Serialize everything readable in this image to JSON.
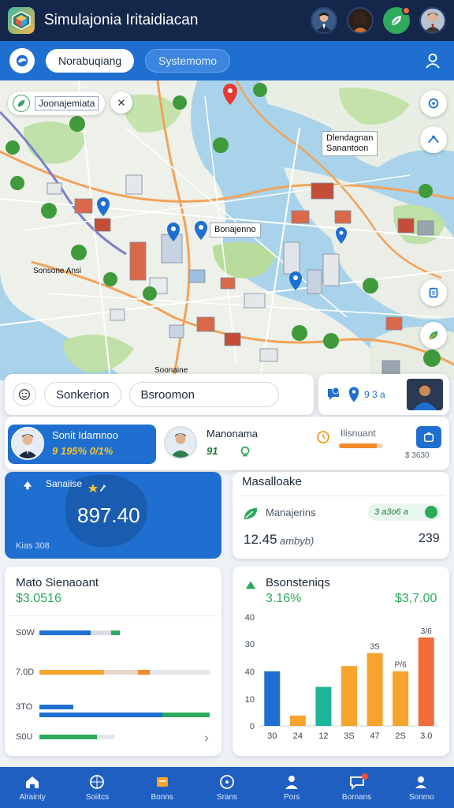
{
  "app": {
    "title": "Simulajonia Iritaidiacan"
  },
  "subbar": {
    "tab_active": "Norabuqiang",
    "tab_inactive": "Systemomo"
  },
  "map": {
    "chip_label": "Joonajemiata",
    "label_right_top_line1": "Dlendagnan",
    "label_right_top_line2": "Sanantoon",
    "label_center": "Bonajenno",
    "label_left": "Sonsone Ansi",
    "label_bottom": "Soonaine"
  },
  "filters": {
    "pill_1": "Sonkerion",
    "pill_2": "Bsroomon",
    "pin_text": "9 3 a"
  },
  "profiles": {
    "a_name": "Sonit Idamnoo",
    "a_sub": "9 195% 0/1%",
    "b_name": "Manonama",
    "b_sub": "91",
    "c_name": "Ilisnuant",
    "c_value": "$ 3630",
    "c_progress": 0.85
  },
  "card_blue": {
    "title": "Sanaiise",
    "value": "897.40",
    "foot": "Kias 308"
  },
  "card_market": {
    "title": "Masalloake",
    "row_label": "Manajerins",
    "row_badge": "3 a3o6 a",
    "row_value": "12.45",
    "row_unit": "ambyb)",
    "row_right": "239"
  },
  "card_hbars": {
    "title": "Mato Sienaoant",
    "value": "$3.0516",
    "rows": [
      {
        "label": "S0W",
        "segments": [
          {
            "v": 0.3,
            "c": "#1f6fd0"
          },
          {
            "v": 0.12,
            "c": "#d9dde3"
          },
          {
            "v": 0.05,
            "c": "#2eaa5c"
          }
        ]
      },
      {
        "label": "7.0D",
        "segments": [
          {
            "v": 0.38,
            "c": "#f6a42c"
          },
          {
            "v": 0.2,
            "c": "#e7d6c8"
          },
          {
            "v": 0.07,
            "c": "#f08a2b"
          },
          {
            "v": 0.35,
            "c": "#e2e6ea"
          }
        ]
      },
      {
        "label": "3TO",
        "segments": [
          {
            "v": 0.2,
            "c": "#1f6fd0"
          }
        ]
      },
      {
        "label": "",
        "segments": [
          {
            "v": 0.72,
            "c": "#1f6fd0"
          },
          {
            "v": 0.28,
            "c": "#2eaa5c"
          }
        ]
      },
      {
        "label": "S0U",
        "segments": [
          {
            "v": 0.34,
            "c": "#2eaa5c"
          },
          {
            "v": 0.1,
            "c": "#e2e6ea"
          }
        ]
      }
    ]
  },
  "card_vbars": {
    "title": "Bsonsteniqs",
    "pct": "3.16%",
    "value": "$3,7.00"
  },
  "chart_data": {
    "type": "bar",
    "title": "",
    "categories": [
      "30",
      "24",
      "12",
      "3S",
      "47",
      "2S",
      "3.0"
    ],
    "values": [
      21,
      4,
      15,
      23,
      28,
      21,
      34
    ],
    "colors": [
      "#1f6fd0",
      "#f6a42c",
      "#1fb59a",
      "#f6a42c",
      "#f6a42c",
      "#f6a42c",
      "#f26b3a"
    ],
    "bar_labels": [
      "",
      "",
      "",
      "",
      "3S",
      "P/6",
      "3/6"
    ],
    "y_ticks": [
      0,
      10,
      40,
      30,
      40
    ],
    "ylim": [
      0,
      40
    ],
    "xlabel": "",
    "ylabel": ""
  },
  "nav": [
    {
      "label": "Alrainty",
      "icon": "home-icon"
    },
    {
      "label": "Soiitcs",
      "icon": "compass-icon"
    },
    {
      "label": "Bonns",
      "icon": "box-icon"
    },
    {
      "label": "Srans",
      "icon": "clock-icon"
    },
    {
      "label": "Pors",
      "icon": "person-icon"
    },
    {
      "label": "Bornans",
      "icon": "chat-icon"
    },
    {
      "label": "Sonmo",
      "icon": "user-search-icon"
    }
  ],
  "colors": {
    "primary": "#1f6fd0",
    "header": "#14264a",
    "accent_green": "#2eaa5c",
    "accent_orange": "#f08a2b"
  }
}
